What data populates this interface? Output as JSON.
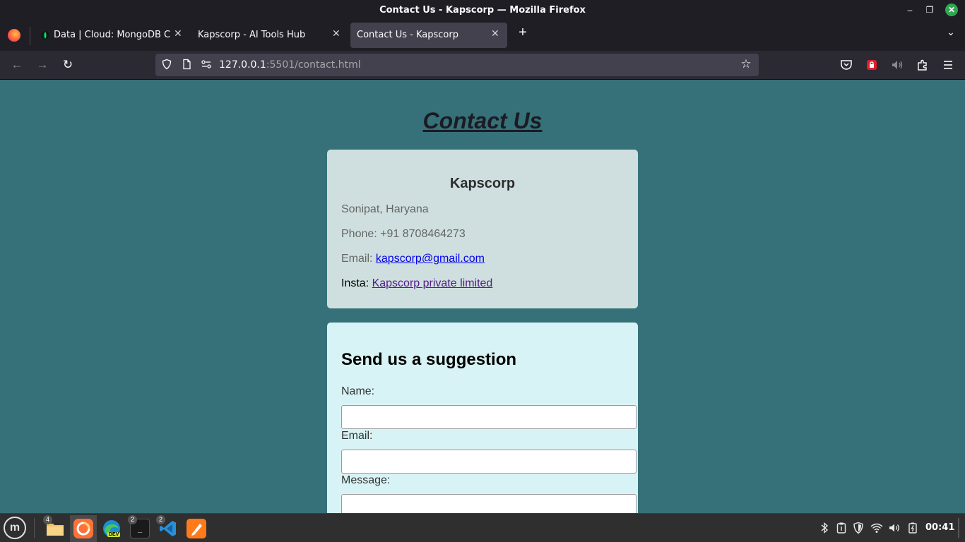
{
  "window": {
    "title": "Contact Us - Kapscorp — Mozilla Firefox",
    "minimize": "–",
    "maximize": "❐",
    "close": "✕"
  },
  "tabs": [
    {
      "label": "Data | Cloud: MongoDB Clo",
      "close": "✕"
    },
    {
      "label": "Kapscorp - AI Tools Hub",
      "close": "✕"
    },
    {
      "label": "Contact Us - Kapscorp",
      "close": "✕",
      "active": true
    }
  ],
  "tabstrip": {
    "new_tab": "+",
    "list_all": "⌄"
  },
  "nav": {
    "back": "←",
    "forward": "→",
    "reload": "↻",
    "url_host": "127.0.0.1",
    "url_rest": ":5501/contact.html",
    "bookmark_star": "☆"
  },
  "page": {
    "title": "Contact Us",
    "company": "Kapscorp",
    "address": "Sonipat, Haryana",
    "phone": "Phone: +91 8708464273",
    "email_label": "Email: ",
    "email": "kapscorp@gmail.com",
    "insta_label": "Insta: ",
    "insta": "Kapscorp private limited",
    "form": {
      "heading": "Send us a suggestion",
      "name_label": "Name:",
      "email_label": "Email:",
      "message_label": "Message:",
      "name_value": "",
      "email_value": "",
      "message_value": ""
    }
  },
  "taskbar": {
    "menu": "m",
    "apps": [
      {
        "name": "files",
        "badge": "4"
      },
      {
        "name": "firefox",
        "badge": ""
      },
      {
        "name": "edge-dev",
        "badge": "",
        "tag": "DEV"
      },
      {
        "name": "terminal",
        "badge": "2"
      },
      {
        "name": "vscode",
        "badge": "2"
      },
      {
        "name": "sublime",
        "badge": ""
      }
    ],
    "clock": "00:41"
  },
  "colors": {
    "page_bg": "#367179",
    "info_card": "#cfdfdf",
    "form_card": "#d8f3f5",
    "link": "#0000ee",
    "visited_link": "#551a8b"
  }
}
